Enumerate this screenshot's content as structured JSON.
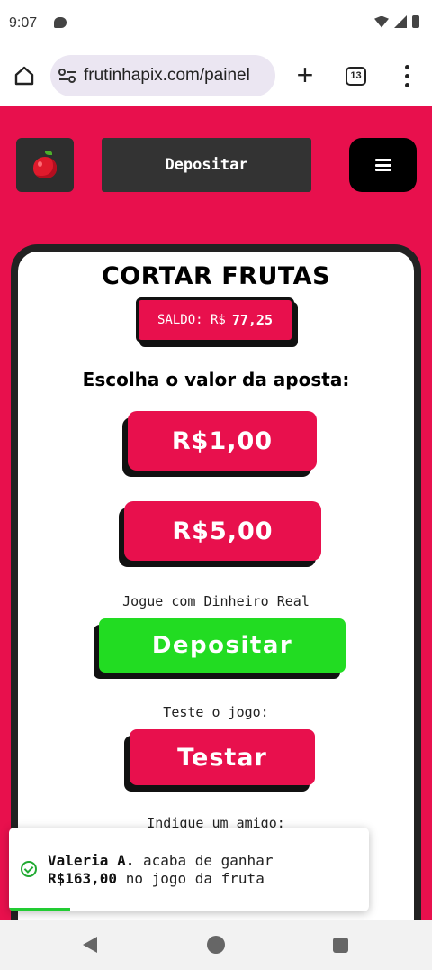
{
  "status_bar": {
    "time": "9:07",
    "icons": [
      "chat-bubble-icon",
      "wifi-icon",
      "signal-icon",
      "battery-icon"
    ]
  },
  "browser": {
    "url": "frutinhapix.com/painel",
    "tab_count": "13",
    "icons": [
      "home-icon",
      "site-settings-icon",
      "new-tab-icon",
      "tabs-icon",
      "more-menu-icon"
    ]
  },
  "header": {
    "logo_icon": "apple-icon",
    "deposit_label": "Depositar",
    "menu_icon": "hamburger-icon"
  },
  "game": {
    "title": "CORTAR FRUTAS",
    "balance_label": "SALDO: R$",
    "balance_value": "77,25",
    "choose_label": "Escolha o valor da aposta:",
    "bets": [
      "R$1,00",
      "R$5,00"
    ],
    "real_money_label": "Jogue com Dinheiro Real",
    "deposit_label": "Depositar",
    "test_label": "Teste o jogo:",
    "test_button": "Testar",
    "refer_label": "Indique um amigo:"
  },
  "toast": {
    "name": "Valeria A.",
    "text1": " acaba de ganhar",
    "amount": "R$163,00",
    "text2": " no jogo da fruta",
    "progress": 0.17
  },
  "colors": {
    "primary": "#e8104d",
    "deposit_green": "#22dc22",
    "dark": "#222222",
    "header_button": "#333333"
  }
}
